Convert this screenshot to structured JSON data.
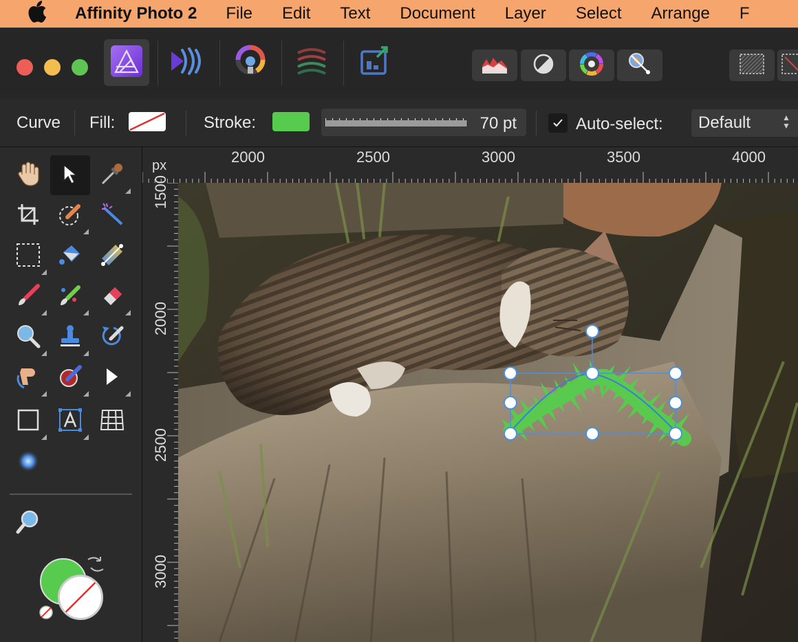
{
  "menubar": {
    "app_name": "Affinity Photo 2",
    "items": [
      "File",
      "Edit",
      "Text",
      "Document",
      "Layer",
      "Select",
      "Arrange",
      "F"
    ]
  },
  "toolbar": {
    "personas": [
      "photo-persona-icon",
      "liquify-persona-icon",
      "develop-persona-icon",
      "tone-mapping-persona-icon",
      "export-persona-icon"
    ],
    "studio_buttons": [
      "histogram-icon",
      "levels-icon",
      "color-wheel-icon",
      "pen-pressure-icon"
    ],
    "right_buttons": [
      "quick-mask-icon",
      "selection-icon"
    ]
  },
  "context": {
    "tool_name": "Curve",
    "fill_label": "Fill:",
    "stroke_label": "Stroke:",
    "stroke_width": "70 pt",
    "autoselect_label": "Auto-select:",
    "autoselect_checked": true,
    "autoselect_value": "Default",
    "stroke_color": "#57cb4d"
  },
  "rulers": {
    "unit": "px",
    "top_labels": [
      "2000",
      "2500",
      "3000",
      "3500",
      "4000"
    ],
    "left_labels": [
      "1500",
      "2000",
      "2500",
      "3000"
    ]
  },
  "colors": {
    "primary_fill": "#57cb4d",
    "accent_selection": "#4a90e2",
    "menubar_bg": "#f6a66d"
  }
}
